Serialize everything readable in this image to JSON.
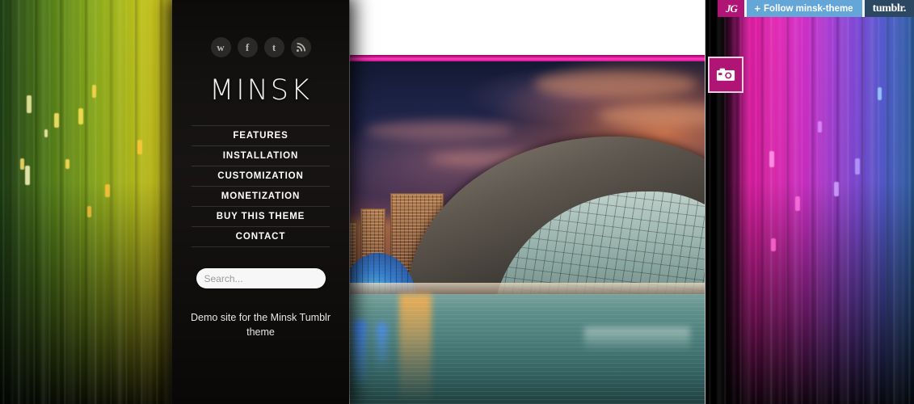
{
  "site": {
    "title": "MINSK",
    "description": "Demo site for the Minsk Tumblr theme"
  },
  "social": [
    {
      "name": "wordpress",
      "glyph": "w"
    },
    {
      "name": "facebook",
      "glyph": "f"
    },
    {
      "name": "twitter",
      "glyph": "t"
    },
    {
      "name": "rss",
      "glyph": ""
    }
  ],
  "nav": {
    "items": [
      {
        "label": "FEATURES"
      },
      {
        "label": "INSTALLATION"
      },
      {
        "label": "CUSTOMIZATION"
      },
      {
        "label": "MONETIZATION"
      },
      {
        "label": "BUY THIS THEME"
      },
      {
        "label": "CONTACT"
      }
    ]
  },
  "search": {
    "value": "",
    "placeholder": "Search...",
    "icon": "magnifier-icon"
  },
  "post": {
    "type_icon": "camera-icon",
    "media": "photo-city-of-arts-and-sciences-valencia-dusk"
  },
  "tumblr_bar": {
    "avatar_initials": "JG",
    "follow_label": "Follow minsk-theme",
    "follow_plus": "+",
    "logo": "tumblr."
  },
  "colors": {
    "accent_pink": "#b01474",
    "rule_pink": "#d5179a",
    "follow_blue": "#64a6d8",
    "tumblr_navy": "#2c4762",
    "sidebar_bg": "#131110",
    "text_light": "#f4f2f0"
  }
}
